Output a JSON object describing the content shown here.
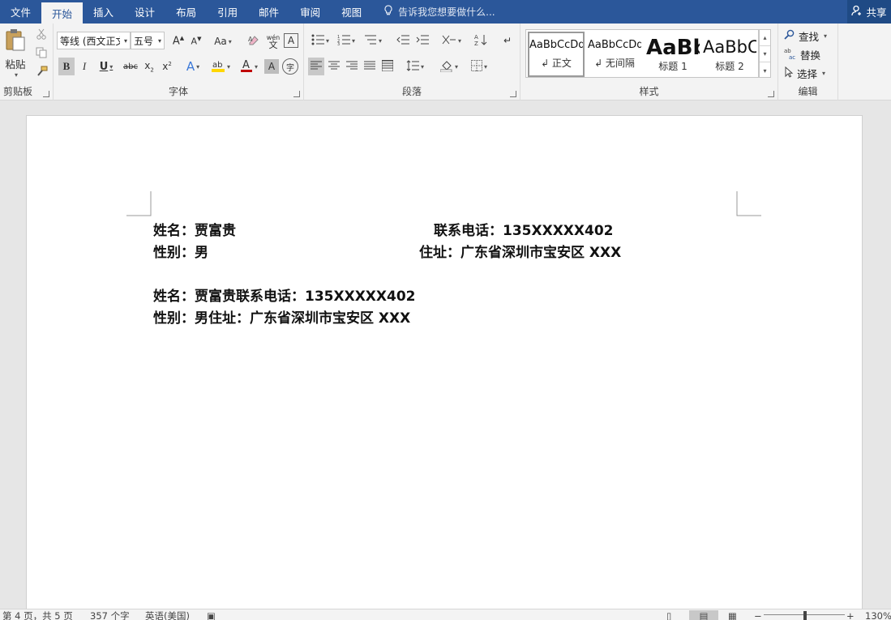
{
  "tabs": [
    "文件",
    "开始",
    "插入",
    "设计",
    "布局",
    "引用",
    "邮件",
    "审阅",
    "视图"
  ],
  "active_tab_index": 1,
  "tell_me": "告诉我您想要做什么...",
  "share": "共享",
  "clipboard": {
    "paste": "粘贴",
    "label": "剪贴板"
  },
  "font": {
    "family": "等线 (西文正文)",
    "size": "五号",
    "change_case": "Aa",
    "wen": "wén",
    "label": "字体"
  },
  "paragraph": {
    "label": "段落"
  },
  "styles": {
    "label": "样式",
    "items": [
      {
        "preview": "AaBbCcDd",
        "name": "↲ 正文"
      },
      {
        "preview": "AaBbCcDd",
        "name": "↲ 无间隔"
      },
      {
        "preview": "AaBb",
        "name": "标题 1"
      },
      {
        "preview": "AaBbC",
        "name": "标题 2"
      }
    ]
  },
  "editing": {
    "find": "查找",
    "replace": "替换",
    "select": "选择",
    "label": "编辑"
  },
  "document": {
    "line1_left": "姓名：贾富贵",
    "line1_right": "联系电话：135XXXXX402",
    "line2_left": "性别：男",
    "line2_right": "住址：广东省深圳市宝安区 XXX",
    "line3": "姓名：贾富贵联系电话：135XXXXX402",
    "line4": "性别：男住址：广东省深圳市宝安区 XXX"
  },
  "status": {
    "page": "第 4 页，共 5 页",
    "words": "357 个字",
    "language": "英语(美国)",
    "zoom": "130%"
  },
  "colors": {
    "brand": "#2b579a",
    "highlight": "#ffd700",
    "font_color": "#c00000"
  }
}
